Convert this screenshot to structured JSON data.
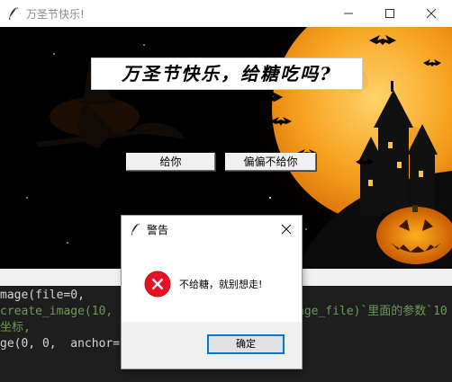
{
  "window": {
    "title": "万圣节快乐!",
    "controls": [
      "minimize",
      "maximize",
      "close"
    ]
  },
  "scene": {
    "banner_text": "万圣节快乐，给糖吃吗?",
    "buttons": {
      "give_label": "给你",
      "not_give_label": "偏偏不给你"
    },
    "colors": {
      "moon": "#f5a623",
      "sky": "#000000",
      "silhouette": "#111111"
    }
  },
  "dialog": {
    "title": "警告",
    "message": "不给糖，就别想走!",
    "ok_label": "确定",
    "icon": "error-icon"
  },
  "editor": {
    "lines": [
      "mage(file=0,",
      "create_image(10, 1",
      "坐标,",
      "ge(0, 0,  anchor="
    ],
    "right_fragment": "age_file)`里面的参数`10"
  }
}
